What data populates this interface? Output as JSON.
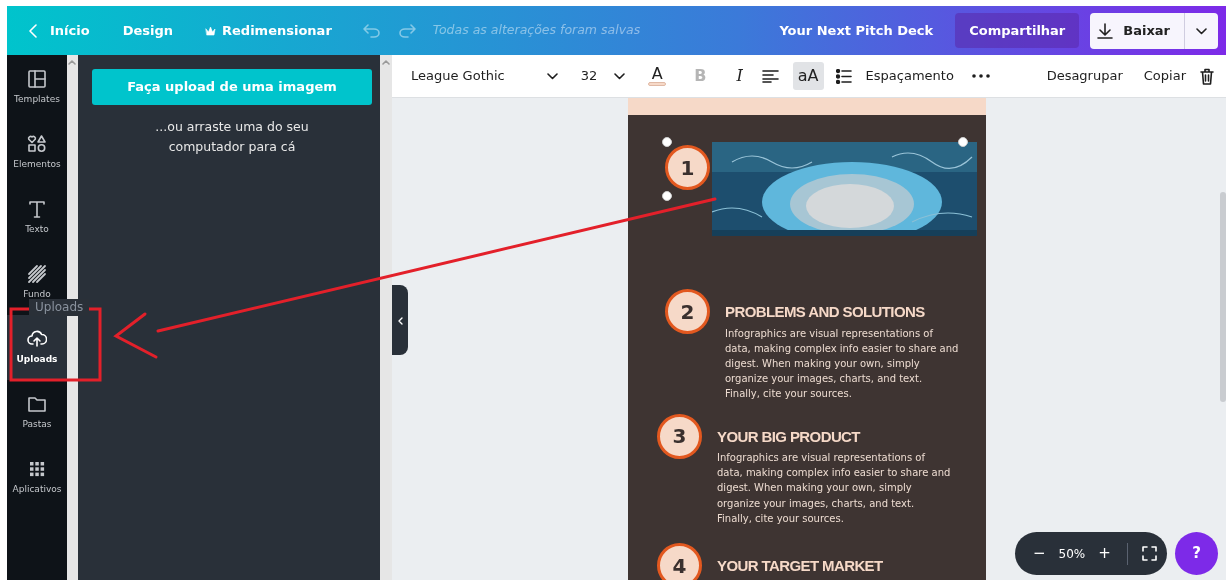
{
  "top_bar": {
    "home": "Início",
    "design": "Design",
    "resize": "Redimensionar",
    "save_status": "Todas as alterações foram salvas",
    "title": "Your Next Pitch Deck",
    "share": "Compartilhar",
    "download": "Baixar"
  },
  "sidebar": {
    "items": [
      {
        "label": "Templates",
        "selected": false
      },
      {
        "label": "Elementos",
        "selected": false
      },
      {
        "label": "Texto",
        "selected": false
      },
      {
        "label": "Fundo",
        "selected": false
      },
      {
        "label": "Uploads",
        "selected": true
      },
      {
        "label": "Pastas",
        "selected": false
      },
      {
        "label": "Aplicativos",
        "selected": false
      }
    ],
    "tooltip": "Uploads"
  },
  "upload_panel": {
    "button": "Faça upload de uma imagem",
    "hint": "...ou arraste uma do seu computador para cá"
  },
  "toolbar": {
    "font": "League Gothic",
    "size": "32",
    "color_letter": "A",
    "styles": [
      {
        "label": "B",
        "disabled": true,
        "selected": false
      },
      {
        "label": "I",
        "disabled": false,
        "selected": false
      },
      {
        "label": "aA",
        "disabled": false,
        "selected": true
      }
    ],
    "spacing": "Espaçamento",
    "ungroup": "Desagrupar",
    "copy": "Copiar"
  },
  "page": {
    "sections": [
      {
        "kind": "picture",
        "number": "1"
      },
      {
        "kind": "text",
        "number": "2",
        "title": "PROBLEMS AND SOLUTIONS",
        "body": "Infographics are visual representations of data, making complex info easier to share and digest. When making your own, simply organize your images, charts, and text. Finally, cite your sources."
      },
      {
        "kind": "text",
        "number": "3",
        "title": "YOUR BIG PRODUCT",
        "body": "Infographics are visual representations of data, making complex info easier to share and digest. When making your own, simply organize your images, charts, and text. Finally, cite your sources."
      },
      {
        "kind": "text",
        "number": "4",
        "title": "YOUR TARGET MARKET"
      }
    ]
  },
  "zoom": {
    "minus": "−",
    "level": "50%",
    "plus": "+"
  },
  "help": "?"
}
